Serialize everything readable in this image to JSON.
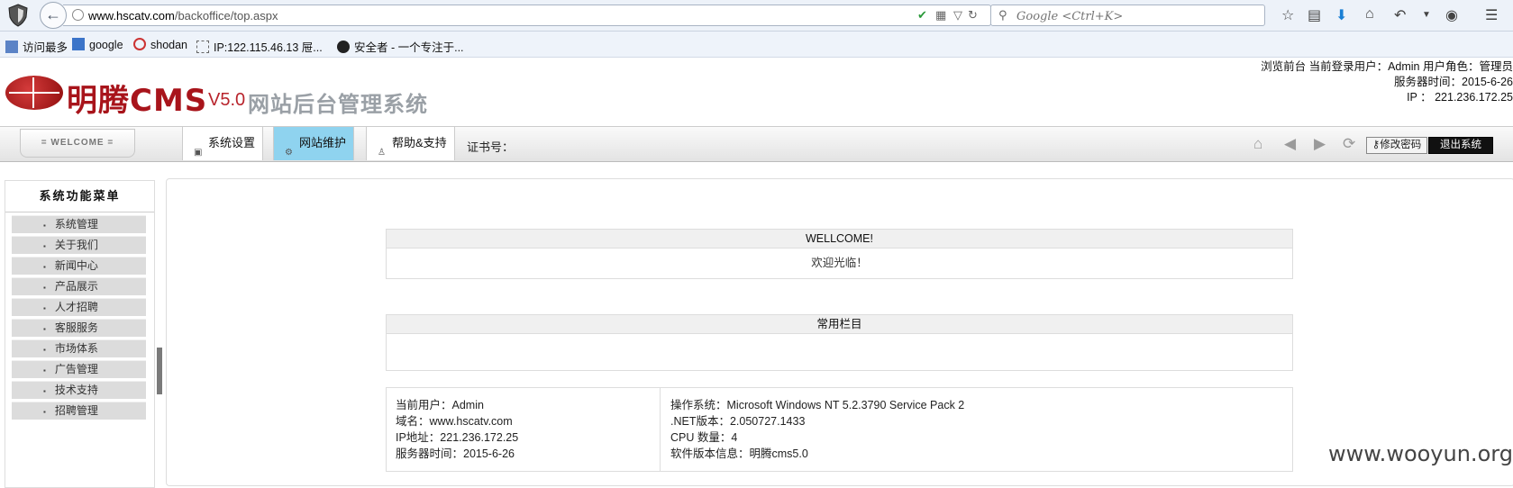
{
  "browser": {
    "url_domain": "www.hscatv.com",
    "url_path": "/backoffice/top.aspx",
    "search_placeholder": "Google <Ctrl+K>"
  },
  "bookmarks": [
    {
      "label": "访问最多"
    },
    {
      "label": "google"
    },
    {
      "label": "shodan"
    },
    {
      "label": "IP:122.115.46.13 屉..."
    },
    {
      "label": "安全者 - 一个专注于..."
    }
  ],
  "header": {
    "brand": "明腾CMS",
    "version": "V5.0",
    "subtitle": "网站后台管理系统",
    "line1": "浏览前台 当前登录用户：Admin 用户角色：管理员",
    "line2": "服务器时间：2015-6-26",
    "line3": "IP ： 221.236.172.25"
  },
  "menubar": {
    "welcome": "= WELCOME =",
    "tabs": [
      {
        "label": "系统设置"
      },
      {
        "label": "网站维护"
      },
      {
        "label": "帮助&支持"
      }
    ],
    "cert_label": "证书号：",
    "change_password": "修改密码",
    "logout": "退出系统"
  },
  "sidebar": {
    "title": "系统功能菜单",
    "items": [
      {
        "label": "系统管理"
      },
      {
        "label": "关于我们"
      },
      {
        "label": "新闻中心"
      },
      {
        "label": "产品展示"
      },
      {
        "label": "人才招聘"
      },
      {
        "label": "客服服务"
      },
      {
        "label": "市场体系"
      },
      {
        "label": "广告管理"
      },
      {
        "label": "技术支持"
      },
      {
        "label": "招聘管理"
      }
    ]
  },
  "main": {
    "welcome_title": "WELLCOME!",
    "welcome_body": "欢迎光临！",
    "common_title": "常用栏目",
    "info_left": [
      "当前用户：Admin",
      "域名：www.hscatv.com",
      "IP地址：221.236.172.25",
      "服务器时间：2015-6-26"
    ],
    "info_right": [
      "操作系统：Microsoft Windows NT 5.2.3790 Service Pack 2",
      ".NET版本：2.050727.1433",
      "CPU 数量：4",
      "软件版本信息：明腾cms5.0"
    ]
  },
  "watermark": "www.wooyun.org"
}
